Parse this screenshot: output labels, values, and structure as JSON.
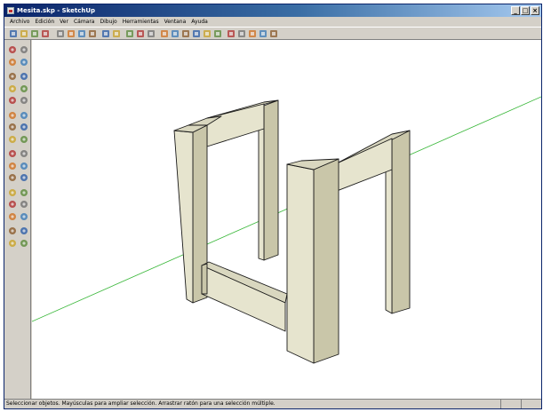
{
  "window": {
    "title": "Mesita.skp - SketchUp",
    "controls": [
      "_",
      "□",
      "×"
    ]
  },
  "menubar": {
    "items": [
      "Archivo",
      "Edición",
      "Ver",
      "Cámara",
      "Dibujo",
      "Herramientas",
      "Ventana",
      "Ayuda"
    ]
  },
  "toolbar": {
    "icons": [
      "select-icon",
      "new-file-icon",
      "open-icon",
      "save-icon",
      "cut-icon",
      "copy-icon",
      "paste-icon",
      "erase-icon",
      "undo-icon",
      "redo-icon",
      "print-icon",
      "model-info-icon",
      "help-icon",
      "iso-view-icon",
      "top-view-icon",
      "front-view-icon",
      "right-view-icon",
      "back-view-icon",
      "left-view-icon",
      "xray-icon",
      "wireframe-icon",
      "hidden-line-icon",
      "shaded-icon",
      "textured-icon"
    ]
  },
  "sidebar": {
    "tools": [
      "select-tool",
      "component-tool",
      "eraser-tool",
      "paint-tool",
      "rectangle-tool",
      "line-tool",
      "circle-tool",
      "arc-tool",
      "polygon-tool",
      "freehand-tool",
      "move-tool",
      "push-pull-tool",
      "rotate-tool",
      "follow-me-tool",
      "scale-tool",
      "offset-tool",
      "tape-measure-tool",
      "dimension-tool",
      "protractor-tool",
      "text-tool",
      "axes-tool",
      "3d-text-tool",
      "orbit-tool",
      "pan-tool",
      "zoom-tool",
      "zoom-window-tool",
      "zoom-extents-tool",
      "previous-view-tool",
      "position-camera-tool",
      "walk-tool",
      "look-around-tool",
      "section-plane-tool"
    ]
  },
  "colors": {
    "title_start": "#0a246a",
    "title_end": "#a6caf0",
    "chrome": "#d4d0c8",
    "wood_face": "#e6e4ce",
    "wood_side": "#c9c6a9",
    "edge": "#1a1a1a",
    "green_axis": "#33b533"
  },
  "statusbar": {
    "text": "Seleccionar objetos. Mayúsculas para ampliar selección. Arrastrar ratón para una selección múltiple."
  }
}
